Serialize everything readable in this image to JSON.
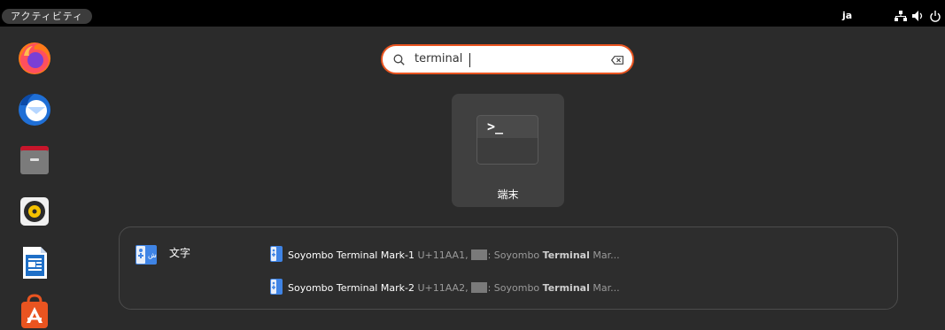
{
  "topbar": {
    "activities_label": "アクティビティ",
    "input_language": "ja"
  },
  "dock": {
    "apps": [
      {
        "name": "firefox"
      },
      {
        "name": "thunderbird"
      },
      {
        "name": "files"
      },
      {
        "name": "rhythmbox"
      },
      {
        "name": "libreoffice-writer"
      },
      {
        "name": "app-center"
      }
    ]
  },
  "search": {
    "query": "terminal"
  },
  "app_results": [
    {
      "label": "端末",
      "prompt_glyph": ">_"
    }
  ],
  "character_results": {
    "provider_label": "文字",
    "items": [
      {
        "name": "Soyombo Terminal Mark-1",
        "codepoint": "U+11AA1,",
        "desc_prefix": ": Soyombo ",
        "desc_bold": "Terminal",
        "desc_suffix": " Mar..."
      },
      {
        "name": "Soyombo Terminal Mark-2",
        "codepoint": "U+11AA2,",
        "desc_prefix": ": Soyombo ",
        "desc_bold": "Terminal",
        "desc_suffix": " Mar..."
      }
    ]
  },
  "colors": {
    "accent": "#e95420",
    "background": "#2b2b2b",
    "topbar": "#000000"
  }
}
